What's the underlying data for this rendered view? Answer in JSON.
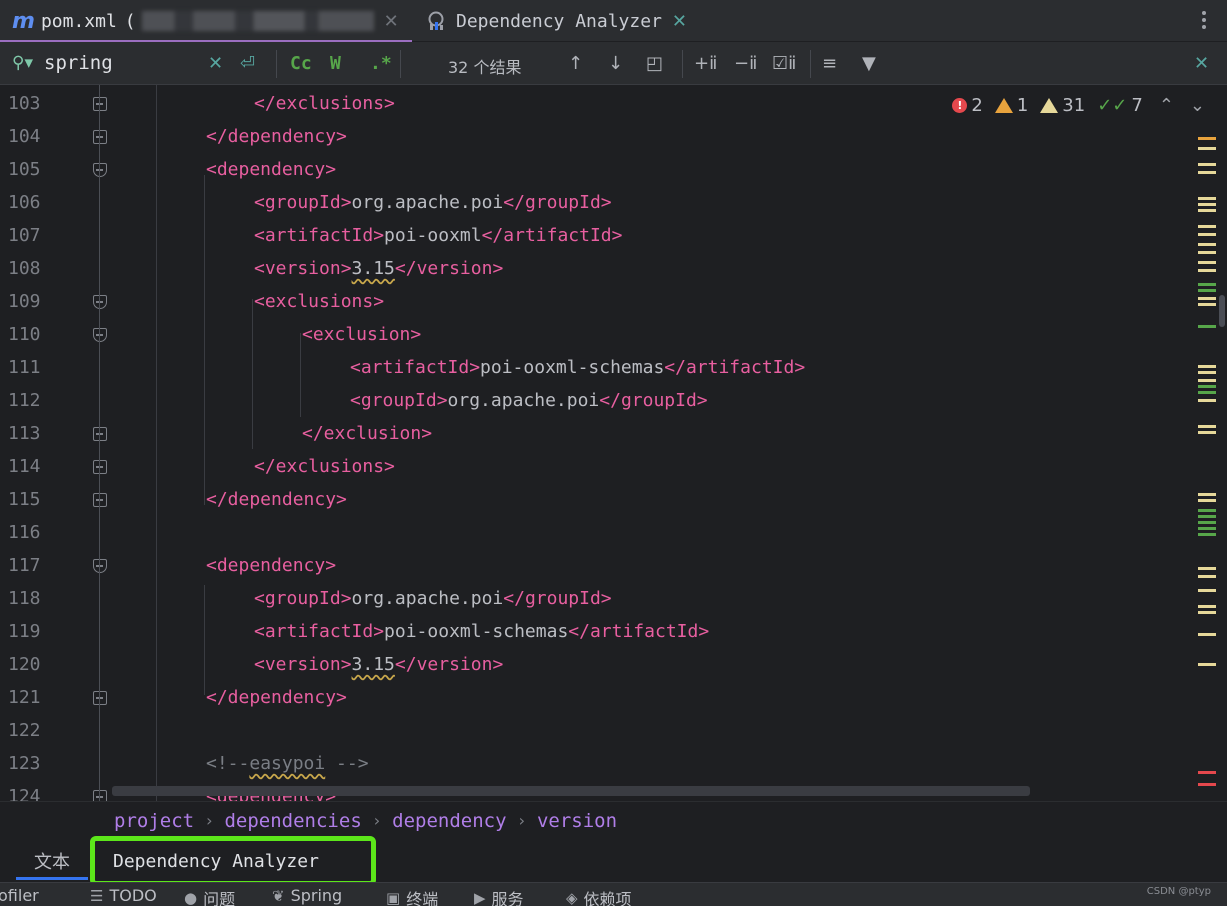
{
  "tabs": [
    {
      "label": "pom.xml",
      "suffix": "(",
      "icon": "maven-icon"
    },
    {
      "label": "Dependency Analyzer",
      "icon": "dependency-analyzer-icon"
    }
  ],
  "find": {
    "query": "spring",
    "result_count": "32 个结果",
    "buttons": {
      "match_case": "Cc",
      "words": "W",
      "regex": ".*"
    }
  },
  "inspections": {
    "errors": "2",
    "warnings": "1",
    "weak_warnings": "31",
    "typos": "7"
  },
  "lines": [
    {
      "n": "103",
      "indent": 3,
      "parts": [
        [
          "tag",
          "</exclusions>"
        ]
      ]
    },
    {
      "n": "104",
      "indent": 2,
      "parts": [
        [
          "tag",
          "</dependency>"
        ]
      ]
    },
    {
      "n": "105",
      "indent": 2,
      "parts": [
        [
          "tag",
          "<dependency>"
        ]
      ]
    },
    {
      "n": "106",
      "indent": 3,
      "parts": [
        [
          "tag",
          "<groupId>"
        ],
        [
          "txt",
          "org.apache.poi"
        ],
        [
          "tag",
          "</groupId>"
        ]
      ]
    },
    {
      "n": "107",
      "indent": 3,
      "parts": [
        [
          "tag",
          "<artifactId>"
        ],
        [
          "txt",
          "poi-ooxml"
        ],
        [
          "tag",
          "</artifactId>"
        ]
      ]
    },
    {
      "n": "108",
      "indent": 3,
      "parts": [
        [
          "tag",
          "<version>"
        ],
        [
          "wavy",
          "3.15"
        ],
        [
          "tag",
          "</version>"
        ]
      ]
    },
    {
      "n": "109",
      "indent": 3,
      "parts": [
        [
          "tag",
          "<exclusions>"
        ]
      ]
    },
    {
      "n": "110",
      "indent": 4,
      "parts": [
        [
          "tag",
          "<exclusion>"
        ]
      ]
    },
    {
      "n": "111",
      "indent": 5,
      "parts": [
        [
          "tag",
          "<artifactId>"
        ],
        [
          "txt",
          "poi-ooxml-schemas"
        ],
        [
          "tag",
          "</artifactId>"
        ]
      ]
    },
    {
      "n": "112",
      "indent": 5,
      "parts": [
        [
          "tag",
          "<groupId>"
        ],
        [
          "txt",
          "org.apache.poi"
        ],
        [
          "tag",
          "</groupId>"
        ]
      ]
    },
    {
      "n": "113",
      "indent": 4,
      "parts": [
        [
          "tag",
          "</exclusion>"
        ]
      ]
    },
    {
      "n": "114",
      "indent": 3,
      "parts": [
        [
          "tag",
          "</exclusions>"
        ]
      ]
    },
    {
      "n": "115",
      "indent": 2,
      "parts": [
        [
          "tag",
          "</dependency>"
        ]
      ]
    },
    {
      "n": "116",
      "indent": 0,
      "parts": []
    },
    {
      "n": "117",
      "indent": 2,
      "parts": [
        [
          "tag",
          "<dependency>"
        ]
      ]
    },
    {
      "n": "118",
      "indent": 3,
      "parts": [
        [
          "tag",
          "<groupId>"
        ],
        [
          "txt",
          "org.apache.poi"
        ],
        [
          "tag",
          "</groupId>"
        ]
      ]
    },
    {
      "n": "119",
      "indent": 3,
      "parts": [
        [
          "tag",
          "<artifactId>"
        ],
        [
          "txt",
          "poi-ooxml-schemas"
        ],
        [
          "tag",
          "</artifactId>"
        ]
      ]
    },
    {
      "n": "120",
      "indent": 3,
      "parts": [
        [
          "tag",
          "<version>"
        ],
        [
          "wavy",
          "3.15"
        ],
        [
          "tag",
          "</version>"
        ]
      ]
    },
    {
      "n": "121",
      "indent": 2,
      "parts": [
        [
          "tag",
          "</dependency>"
        ]
      ]
    },
    {
      "n": "122",
      "indent": 0,
      "parts": []
    },
    {
      "n": "123",
      "indent": 2,
      "parts": [
        [
          "cmt",
          "<!--"
        ],
        [
          "cmtw",
          "easypoi"
        ],
        [
          "cmt",
          " -->"
        ]
      ]
    },
    {
      "n": "124",
      "indent": 2,
      "parts": [
        [
          "tag",
          "<dependency>"
        ]
      ]
    }
  ],
  "breadcrumb": [
    "project",
    "dependencies",
    "dependency",
    "version"
  ],
  "editor_tabs": {
    "text": "文本",
    "dependency_analyzer": "Dependency Analyzer"
  },
  "tool_windows": [
    {
      "label": "ofiler",
      "icon": ""
    },
    {
      "label": "TODO",
      "icon": "list-icon"
    },
    {
      "label": "问题",
      "icon": "problems-icon"
    },
    {
      "label": "Spring",
      "icon": "spring-icon"
    },
    {
      "label": "终端",
      "icon": "terminal-icon"
    },
    {
      "label": "服务",
      "icon": "services-icon"
    },
    {
      "label": "依赖项",
      "icon": "dependencies-icon"
    }
  ],
  "watermark": "CSDN @ptyp",
  "colors": {
    "tag": "#e85fa0",
    "breadcrumb": "#b07ee8",
    "highlight_box": "#5ce61a",
    "accent": "#3574f0"
  }
}
